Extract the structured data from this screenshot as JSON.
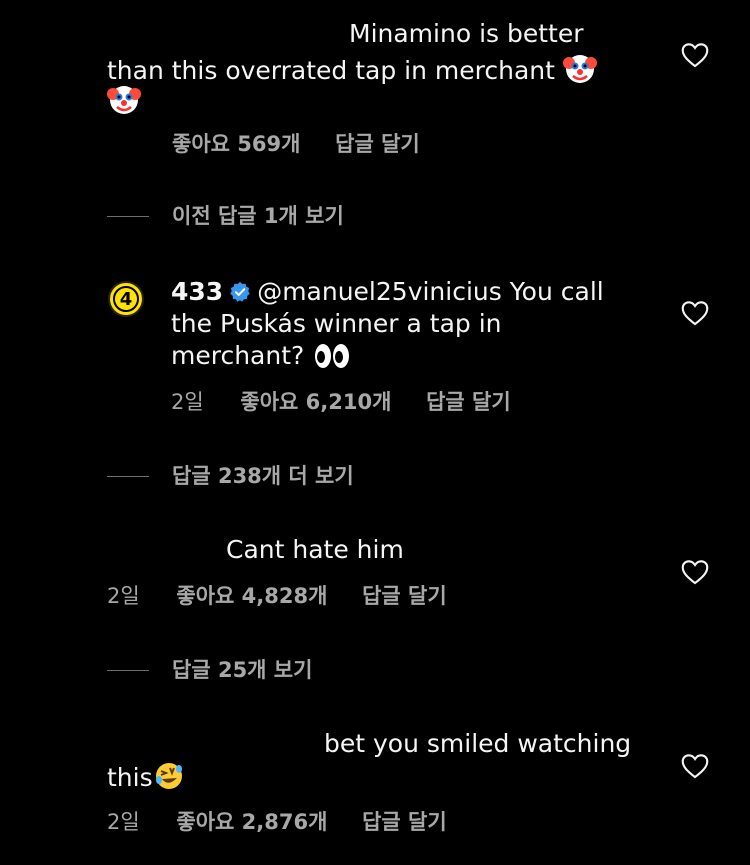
{
  "comments": [
    {
      "text_line1": "Minamino is better",
      "text_line2": "than this overrated tap in merchant",
      "likes": "좋아요 569개",
      "reply": "답글 달기"
    },
    {
      "username": "433",
      "avatar_text": "4",
      "text_line1": "@manuel25vinicius You call",
      "text_line2": "the Puskás winner a tap in",
      "text_line3": "merchant?",
      "time": "2일",
      "likes": "좋아요 6,210개",
      "reply": "답글 달기"
    },
    {
      "text_line1": "Cant hate him",
      "time": "2일",
      "likes": "좋아요 4,828개",
      "reply": "답글 달기"
    },
    {
      "text_line1": "bet you smiled watching",
      "text_line2": "this",
      "time": "2일",
      "likes": "좋아요 2,876개",
      "reply": "답글 달기"
    }
  ],
  "view_previous": "이전 답글 1개 보기",
  "view_more_238": "답글 238개 더 보기",
  "view_25": "답글 25개 보기",
  "icons": {
    "heart": "heart-outline-icon",
    "verified": "verified-badge-icon",
    "clown": "clown-face-emoji",
    "eyes": "eyes-emoji",
    "rofl": "rolling-on-floor-laughing-emoji"
  },
  "colors": {
    "background": "#000000",
    "text": "#f5f5f5",
    "meta": "#a8a8a8",
    "verified": "#3897f0",
    "avatar": "#ffe200"
  }
}
